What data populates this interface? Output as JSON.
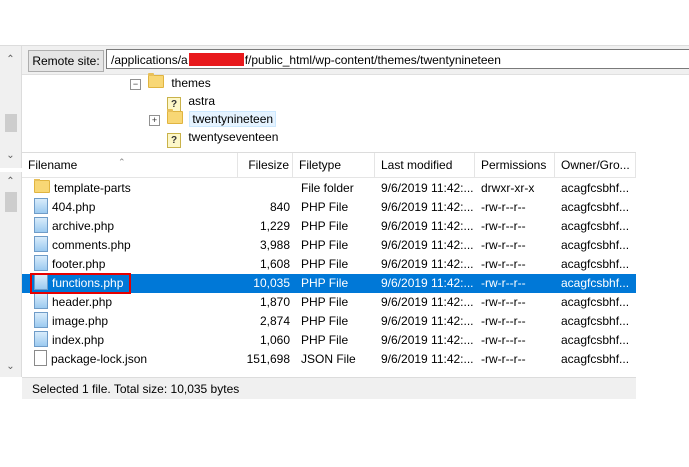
{
  "remote_site": {
    "label": "Remote site:",
    "path_prefix": "/applications/a",
    "path_suffix": "f/public_html/wp-content/themes/twentynineteen"
  },
  "tree": {
    "items": [
      {
        "label": "themes",
        "icon": "folder-icon",
        "expander": "−"
      },
      {
        "label": "astra",
        "icon": "question-folder-icon"
      },
      {
        "label": "twentynineteen",
        "icon": "folder-icon",
        "expander": "+"
      },
      {
        "label": "twentyseventeen",
        "icon": "question-folder-icon"
      }
    ]
  },
  "list": {
    "columns": [
      "Filename",
      "Filesize",
      "Filetype",
      "Last modified",
      "Permissions",
      "Owner/Gro..."
    ],
    "rows": [
      {
        "name": "template-parts",
        "size": "",
        "type": "File folder",
        "modified": "9/6/2019 11:42:...",
        "perms": "drwxr-xr-x",
        "owner": "acagfcsbhf...",
        "icon": "folder"
      },
      {
        "name": "404.php",
        "size": "840",
        "type": "PHP File",
        "modified": "9/6/2019 11:42:...",
        "perms": "-rw-r--r--",
        "owner": "acagfcsbhf...",
        "icon": "php"
      },
      {
        "name": "archive.php",
        "size": "1,229",
        "type": "PHP File",
        "modified": "9/6/2019 11:42:...",
        "perms": "-rw-r--r--",
        "owner": "acagfcsbhf...",
        "icon": "php"
      },
      {
        "name": "comments.php",
        "size": "3,988",
        "type": "PHP File",
        "modified": "9/6/2019 11:42:...",
        "perms": "-rw-r--r--",
        "owner": "acagfcsbhf...",
        "icon": "php"
      },
      {
        "name": "footer.php",
        "size": "1,608",
        "type": "PHP File",
        "modified": "9/6/2019 11:42:...",
        "perms": "-rw-r--r--",
        "owner": "acagfcsbhf...",
        "icon": "php"
      },
      {
        "name": "functions.php",
        "size": "10,035",
        "type": "PHP File",
        "modified": "9/6/2019 11:42:...",
        "perms": "-rw-r--r--",
        "owner": "acagfcsbhf...",
        "icon": "php",
        "selected": true
      },
      {
        "name": "header.php",
        "size": "1,870",
        "type": "PHP File",
        "modified": "9/6/2019 11:42:...",
        "perms": "-rw-r--r--",
        "owner": "acagfcsbhf...",
        "icon": "php"
      },
      {
        "name": "image.php",
        "size": "2,874",
        "type": "PHP File",
        "modified": "9/6/2019 11:42:...",
        "perms": "-rw-r--r--",
        "owner": "acagfcsbhf...",
        "icon": "php"
      },
      {
        "name": "index.php",
        "size": "1,060",
        "type": "PHP File",
        "modified": "9/6/2019 11:42:...",
        "perms": "-rw-r--r--",
        "owner": "acagfcsbhf...",
        "icon": "php"
      },
      {
        "name": "package-lock.json",
        "size": "151,698",
        "type": "JSON File",
        "modified": "9/6/2019 11:42:...",
        "perms": "-rw-r--r--",
        "owner": "acagfcsbhf...",
        "icon": "json"
      }
    ]
  },
  "status": {
    "text": "Selected 1 file. Total size: 10,035 bytes"
  },
  "colors": {
    "selection": "#0078d7",
    "highlight_box": "#e60000"
  }
}
